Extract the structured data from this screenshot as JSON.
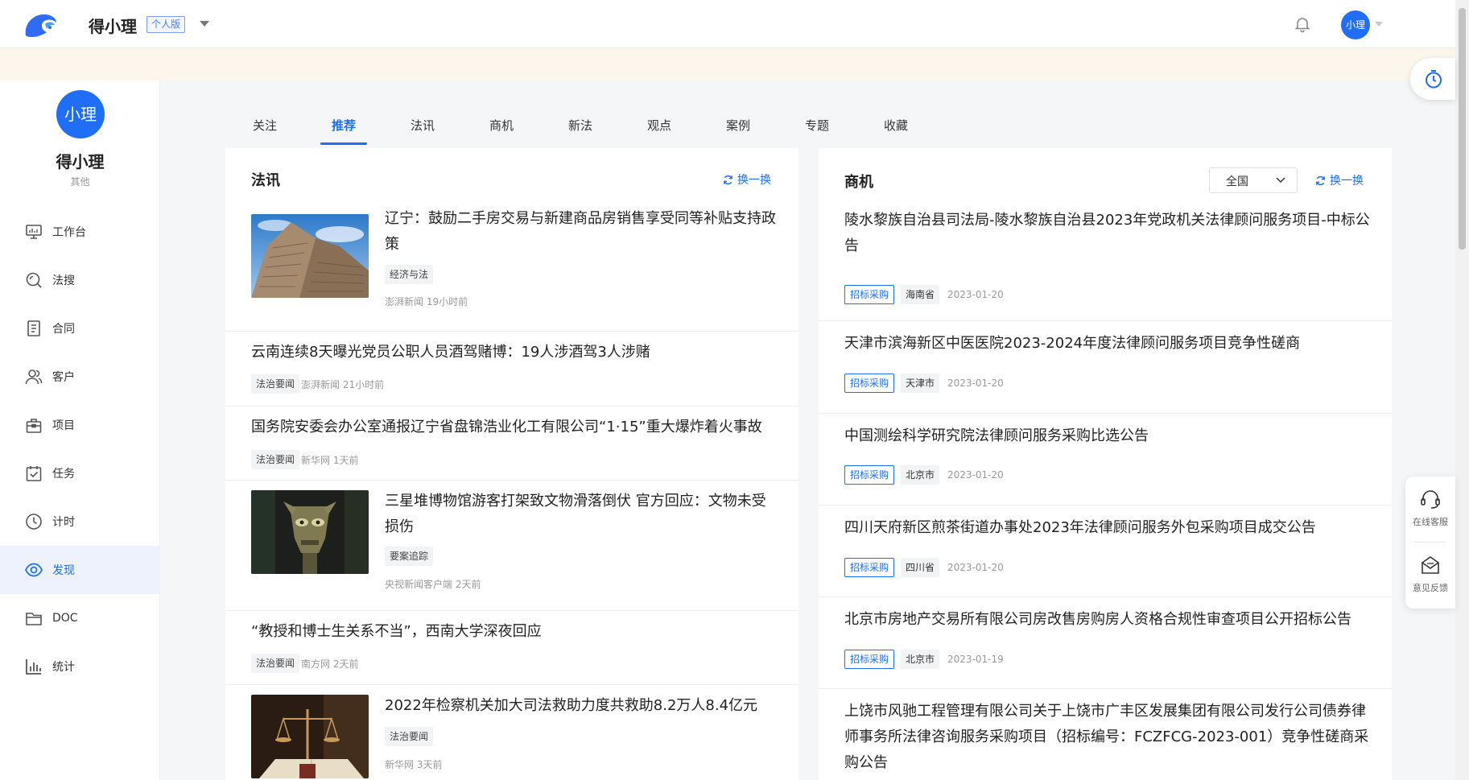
{
  "header": {
    "app_name": "得小理",
    "edition": "个人版",
    "avatar_text": "小理"
  },
  "sidebar": {
    "avatar_text": "小理",
    "user_name": "得小理",
    "role": "其他",
    "items": [
      {
        "label": "工作台",
        "icon": "monitor-icon"
      },
      {
        "label": "法搜",
        "icon": "search-icon"
      },
      {
        "label": "合同",
        "icon": "contract-icon"
      },
      {
        "label": "客户",
        "icon": "users-icon"
      },
      {
        "label": "项目",
        "icon": "project-icon"
      },
      {
        "label": "任务",
        "icon": "calendar-check-icon"
      },
      {
        "label": "计时",
        "icon": "clock-icon"
      },
      {
        "label": "发现",
        "icon": "eye-icon",
        "active": true
      },
      {
        "label": "DOC",
        "icon": "folder-icon"
      },
      {
        "label": "统计",
        "icon": "bar-chart-icon"
      }
    ]
  },
  "tabs": [
    {
      "label": "关注"
    },
    {
      "label": "推荐",
      "active": true
    },
    {
      "label": "法讯"
    },
    {
      "label": "商机"
    },
    {
      "label": "新法"
    },
    {
      "label": "观点"
    },
    {
      "label": "案例"
    },
    {
      "label": "专题"
    },
    {
      "label": "收藏"
    }
  ],
  "news": {
    "title": "法讯",
    "refresh_label": "换一换",
    "items": [
      {
        "title_l1": "辽宁：鼓励二手房交易与新建商品房销售享受同等补贴支持政",
        "title_l2": "策",
        "tag": "经济与法",
        "source": "澎湃新闻 19小时前"
      },
      {
        "title": "云南连续8天曝光党员公职人员酒驾赌博：19人涉酒驾3人涉赌",
        "tag": "法治要闻",
        "source": "澎湃新闻 21小时前"
      },
      {
        "title": "国务院安委会办公室通报辽宁省盘锦浩业化工有限公司“1·15”重大爆炸着火事故",
        "tag": "法治要闻",
        "source": "新华网 1天前"
      },
      {
        "title_l1": "三星堆博物馆游客打架致文物滑落倒伏 官方回应：文物未受",
        "title_l2": "损伤",
        "tag": "要案追踪",
        "source": "央视新闻客户端 2天前"
      },
      {
        "title": "“教授和博士生关系不当”，西南大学深夜回应",
        "tag": "法治要闻",
        "source": "南方网 2天前"
      },
      {
        "title": "2022年检察机关加大司法救助力度共救助8.2万人8.4亿元",
        "tag": "法治要闻",
        "source": "新华网 3天前"
      }
    ]
  },
  "business": {
    "title": "商机",
    "region": "全国",
    "refresh_label": "换一换",
    "items": [
      {
        "title_l1": "陵水黎族自治县司法局-陵水黎族自治县2023年党政机关法律顾问服务项目-中标公",
        "title_l2": "告",
        "type": "招标采购",
        "region": "海南省",
        "date": "2023-01-20"
      },
      {
        "title": "天津市滨海新区中医医院2023-2024年度法律顾问服务项目竞争性磋商",
        "type": "招标采购",
        "region": "天津市",
        "date": "2023-01-20"
      },
      {
        "title": "中国测绘科学研究院法律顾问服务采购比选公告",
        "type": "招标采购",
        "region": "北京市",
        "date": "2023-01-20"
      },
      {
        "title": "四川天府新区煎茶街道办事处2023年法律顾问服务外包采购项目成交公告",
        "type": "招标采购",
        "region": "四川省",
        "date": "2023-01-20"
      },
      {
        "title": "北京市房地产交易所有限公司房改售房购房人资格合规性审查项目公开招标公告",
        "type": "招标采购",
        "region": "北京市",
        "date": "2023-01-19"
      },
      {
        "title_l1": "上饶市风驰工程管理有限公司关于上饶市广丰区发展集团有限公司发行公司债券律",
        "title_l2": "师事务所法律咨询服务采购项目（招标编号：FCZFCG-2023-001）竞争性磋商采",
        "title_l3": "购公告"
      }
    ]
  },
  "float": {
    "service_label": "在线客服",
    "feedback_label": "意见反馈"
  },
  "colors": {
    "primary": "#1f6ef5",
    "notice_bg": "#fdf6ec"
  }
}
